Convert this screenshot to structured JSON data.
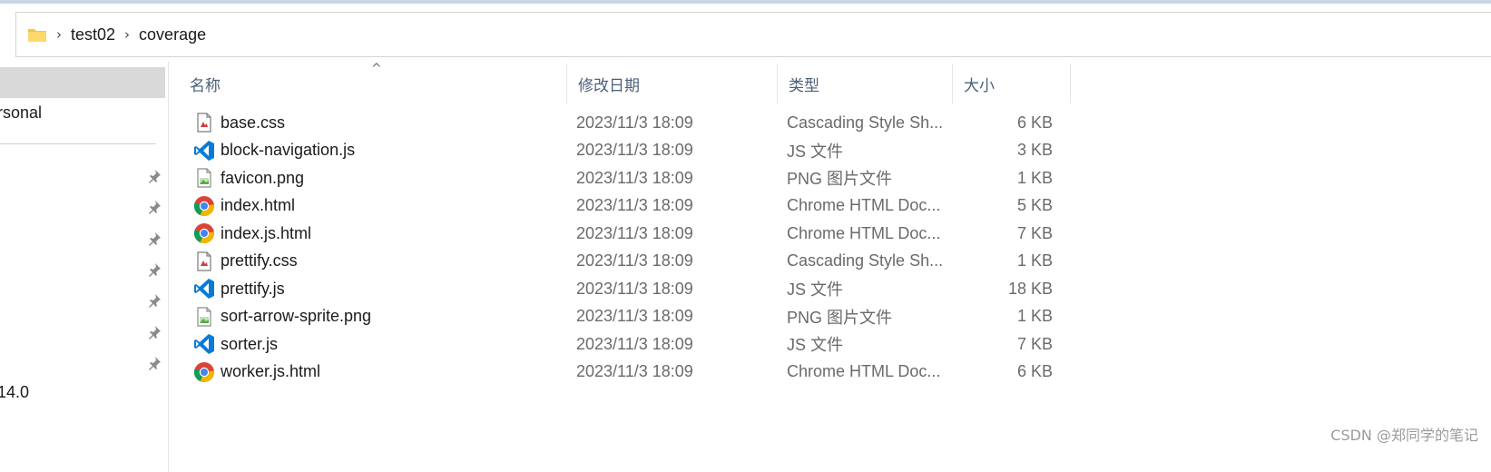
{
  "breadcrumb": {
    "items": [
      "test02",
      "coverage"
    ],
    "separator": "›",
    "folder_icon": "folder-icon"
  },
  "nav": {
    "item_personal": "rsonal",
    "item_version": "14.0",
    "pin_icon": "pin-icon"
  },
  "columns": {
    "name": "名称",
    "date": "修改日期",
    "type": "类型",
    "size": "大小",
    "sort_indicator": "^"
  },
  "files": [
    {
      "name": "base.css",
      "date": "2023/11/3 18:09",
      "type": "Cascading Style Sh...",
      "size": "6 KB",
      "icon": "css-file-icon"
    },
    {
      "name": "block-navigation.js",
      "date": "2023/11/3 18:09",
      "type": "JS 文件",
      "size": "3 KB",
      "icon": "vscode-js-icon"
    },
    {
      "name": "favicon.png",
      "date": "2023/11/3 18:09",
      "type": "PNG 图片文件",
      "size": "1 KB",
      "icon": "png-file-icon"
    },
    {
      "name": "index.html",
      "date": "2023/11/3 18:09",
      "type": "Chrome HTML Doc...",
      "size": "5 KB",
      "icon": "chrome-icon"
    },
    {
      "name": "index.js.html",
      "date": "2023/11/3 18:09",
      "type": "Chrome HTML Doc...",
      "size": "7 KB",
      "icon": "chrome-icon"
    },
    {
      "name": "prettify.css",
      "date": "2023/11/3 18:09",
      "type": "Cascading Style Sh...",
      "size": "1 KB",
      "icon": "css-file-icon"
    },
    {
      "name": "prettify.js",
      "date": "2023/11/3 18:09",
      "type": "JS 文件",
      "size": "18 KB",
      "icon": "vscode-js-icon"
    },
    {
      "name": "sort-arrow-sprite.png",
      "date": "2023/11/3 18:09",
      "type": "PNG 图片文件",
      "size": "1 KB",
      "icon": "png-file-icon"
    },
    {
      "name": "sorter.js",
      "date": "2023/11/3 18:09",
      "type": "JS 文件",
      "size": "7 KB",
      "icon": "vscode-js-icon"
    },
    {
      "name": "worker.js.html",
      "date": "2023/11/3 18:09",
      "type": "Chrome HTML Doc...",
      "size": "6 KB",
      "icon": "chrome-icon"
    }
  ],
  "watermark": "CSDN @郑同学的笔记",
  "colors": {
    "selection": "#d9d9d9",
    "header_text": "#4c607a",
    "secondary_text": "#6a6a6a",
    "vscode_blue": "#0a7ad6",
    "folder_yellow": "#f5c542"
  }
}
